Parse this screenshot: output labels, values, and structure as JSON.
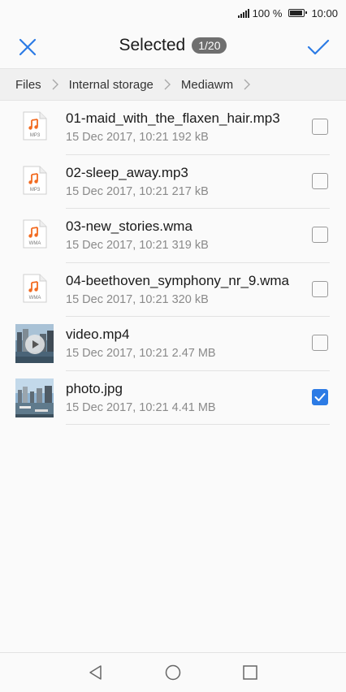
{
  "status_bar": {
    "battery_text": "100 %",
    "time": "10:00"
  },
  "header": {
    "title": "Selected",
    "badge": "1/20"
  },
  "breadcrumb": [
    "Files",
    "Internal storage",
    "Mediawm"
  ],
  "colors": {
    "accent": "#2c7be5",
    "music": "#f26b21"
  },
  "files": [
    {
      "name": "01-maid_with_the_flaxen_hair.mp3",
      "meta": "15 Dec 2017, 10:21 192 kB",
      "type_label": "MP3",
      "icon": "music-file-icon",
      "checked": false
    },
    {
      "name": "02-sleep_away.mp3",
      "meta": "15 Dec 2017, 10:21 217 kB",
      "type_label": "MP3",
      "icon": "music-file-icon",
      "checked": false
    },
    {
      "name": "03-new_stories.wma",
      "meta": "15 Dec 2017, 10:21 319 kB",
      "type_label": "WMA",
      "icon": "music-file-icon",
      "checked": false
    },
    {
      "name": "04-beethoven_symphony_nr_9.wma",
      "meta": "15 Dec 2017, 10:21 320 kB",
      "type_label": "WMA",
      "icon": "music-file-icon",
      "checked": false
    },
    {
      "name": "video.mp4",
      "meta": "15 Dec 2017, 10:21 2.47 MB",
      "type_label": "",
      "icon": "video-thumbnail",
      "checked": false
    },
    {
      "name": "photo.jpg",
      "meta": "15 Dec 2017, 10:21 4.41 MB",
      "type_label": "",
      "icon": "photo-thumbnail",
      "checked": true
    }
  ]
}
